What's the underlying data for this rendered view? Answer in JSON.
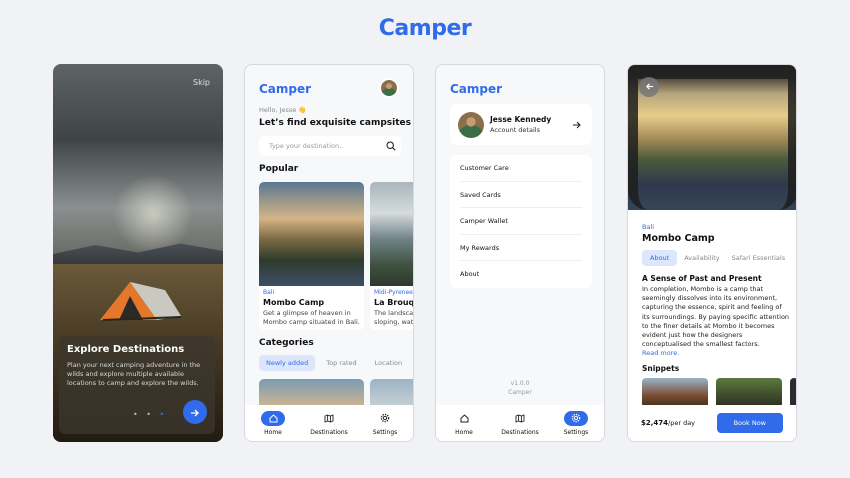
{
  "brand": "Camper",
  "onboarding": {
    "skip": "Skip",
    "title": "Explore Destinations",
    "text": "Plan your next camping adventure in the wilds and explore multiple available locations to camp and explore the wilds.",
    "dots": "• • •",
    "next_icon": "arrow-right-icon",
    "page_index": 3,
    "page_count": 3
  },
  "home": {
    "logo": "Camper",
    "greeting": "Hello, Jesse 👋",
    "headline": "Let’s find exquisite campsites",
    "search_placeholder": "Type your destination..",
    "popular_title": "Popular",
    "popular": [
      {
        "location": "Bali",
        "name": "Mombo Camp",
        "desc1": "Get a glimpse of heaven in",
        "desc2": "Mombo camp situated in Bali."
      },
      {
        "location": "Midi-Pyrenees",
        "name": "La Brouquo",
        "desc1": "The landscap",
        "desc2": "sloping, watc"
      }
    ],
    "categories_title": "Categories",
    "categories": [
      "Newly added",
      "Top rated",
      "Location"
    ]
  },
  "tabs": {
    "home": "Home",
    "destinations": "Destinations",
    "settings": "Settings"
  },
  "account": {
    "logo": "Camper",
    "name": "Jesse Kennedy",
    "sub": "Account details",
    "menu": [
      "Customer Care",
      "Saved Cards",
      "Camper Wallet",
      "My Rewards",
      "About"
    ],
    "version": "v1.0.0",
    "app": "Camper"
  },
  "detail": {
    "location": "Bali",
    "name": "Mombo Camp",
    "tabs": [
      "About",
      "Availability",
      "Safari Essentials"
    ],
    "heading": "A Sense of Past and Present",
    "paragraph": "In completion, Mombo is a camp that seemingly dissolves into its environment, capturing the essence, spirit and feeling of its surroundings. By paying specific attention to the finer details at Mombo it becomes evident just how the designers conceptualised the smallest factors.",
    "read_more": "Read more.",
    "snippets_title": "Snippets",
    "price": "$2,474",
    "price_unit": "/per day",
    "book": "Book Now"
  },
  "colors": {
    "accent": "#2f6bea",
    "accent_soft": "#dce7fb"
  }
}
